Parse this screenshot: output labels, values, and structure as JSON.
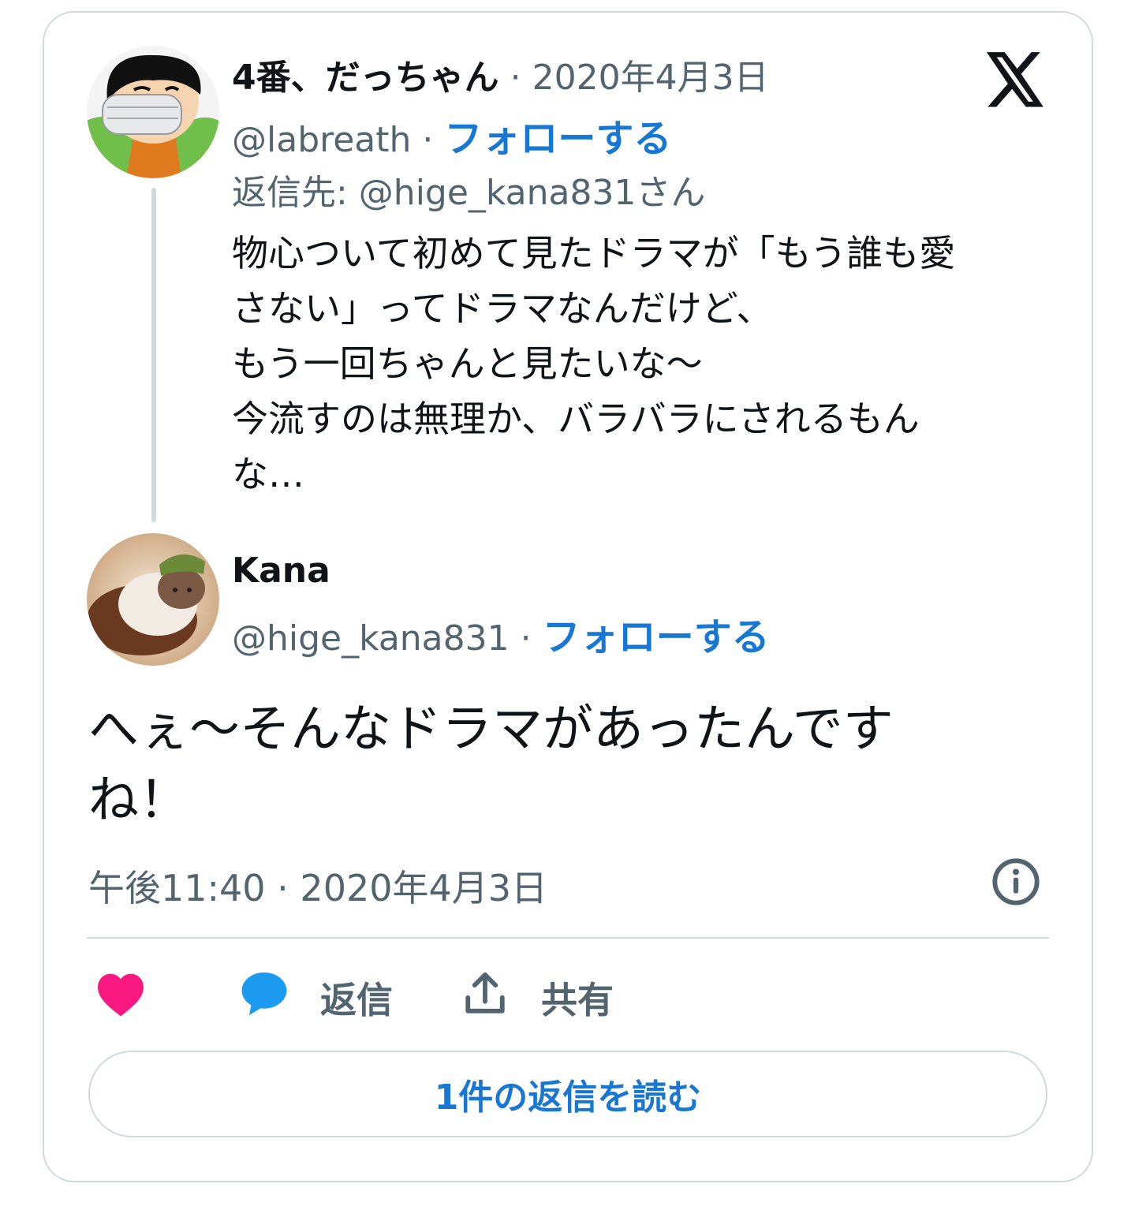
{
  "quoted_tweet": {
    "display_name": "4番、だっちゃん",
    "separator": "·",
    "date": "2020年4月3日",
    "handle": "@labreath",
    "follow_label": "フォローする",
    "reply_to": "返信先: @hige_kana831さん",
    "text_lines": [
      "物心ついて初めて見たドラマが「もう誰も愛",
      "さない」ってドラマなんだけど、",
      "もう一回ちゃんと見たいな〜",
      "今流すのは無理か、バラバラにされるもん",
      "な…"
    ]
  },
  "main_tweet": {
    "display_name": "Kana",
    "handle": "@hige_kana831",
    "separator": "·",
    "follow_label": "フォローする",
    "text_lines": [
      "へぇ〜そんなドラマがあったんです",
      "ね！"
    ],
    "timestamp": "午後11:40 · 2020年4月3日"
  },
  "actions": {
    "reply_label": "返信",
    "share_label": "共有"
  },
  "read_replies_label": "1件の返信を読む",
  "icons": {
    "brand": "x-logo-icon",
    "info": "info-icon",
    "like": "heart-icon",
    "reply": "speech-bubble-icon",
    "share": "share-upload-icon"
  },
  "colors": {
    "link": "#1877d2",
    "like": "#f91880",
    "reply_icon": "#1d9bf0",
    "muted": "#536471",
    "border": "#cfd9de"
  }
}
